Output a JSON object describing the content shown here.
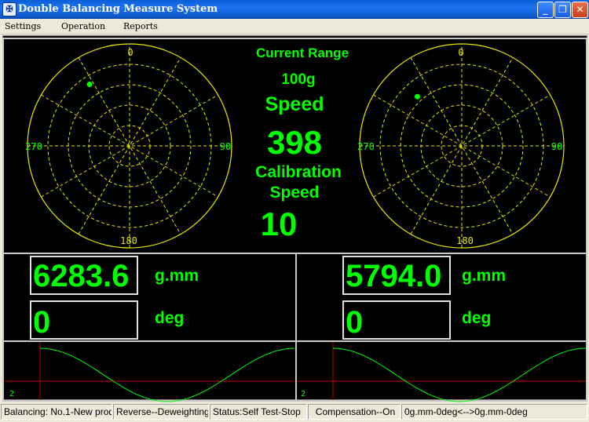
{
  "window": {
    "title": "Double Balancing Measure System",
    "icon": "app-icon",
    "controls": {
      "minimize": "_",
      "maximize": "❐",
      "close": "✕"
    }
  },
  "menu": {
    "settings": "Settings",
    "operation": "Operation",
    "reports": "Reports"
  },
  "polar_left": {
    "labels": {
      "top": "0",
      "right": "90",
      "bottom": "180",
      "left": "270"
    },
    "point_angle_deg": 327,
    "point_radius_fraction": 0.72
  },
  "polar_right": {
    "labels": {
      "top": "0",
      "right": "90",
      "bottom": "180",
      "left": "270"
    },
    "point_angle_deg": 318,
    "point_radius_fraction": 0.65
  },
  "center": {
    "current_range_label": "Current Range",
    "current_range_value": "100g",
    "speed_label": "Speed",
    "speed_value": "398",
    "calibration_label": "Calibration",
    "calibration_speed_label": "Speed",
    "calibration_value": "10"
  },
  "left_channel": {
    "amount": "6283.6",
    "amount_unit": "g.mm",
    "angle": "0",
    "angle_unit": "deg",
    "wave_label": "2"
  },
  "right_channel": {
    "amount": "5794.0",
    "amount_unit": "g.mm",
    "angle": "0",
    "angle_unit": "deg",
    "wave_label": "2"
  },
  "status": {
    "balancing": "Balancing:  No.1-New prod",
    "mode": "Reverse--Deweighting",
    "state": "Status:Self Test-Stop",
    "compensation": "Compensation--On",
    "range": "0g.mm-0deg<-->0g.mm-0deg"
  },
  "colors": {
    "display_green": "#00ff00",
    "polar_yellow": "#e8e800",
    "axis_red": "#c00000",
    "background": "#000000"
  }
}
